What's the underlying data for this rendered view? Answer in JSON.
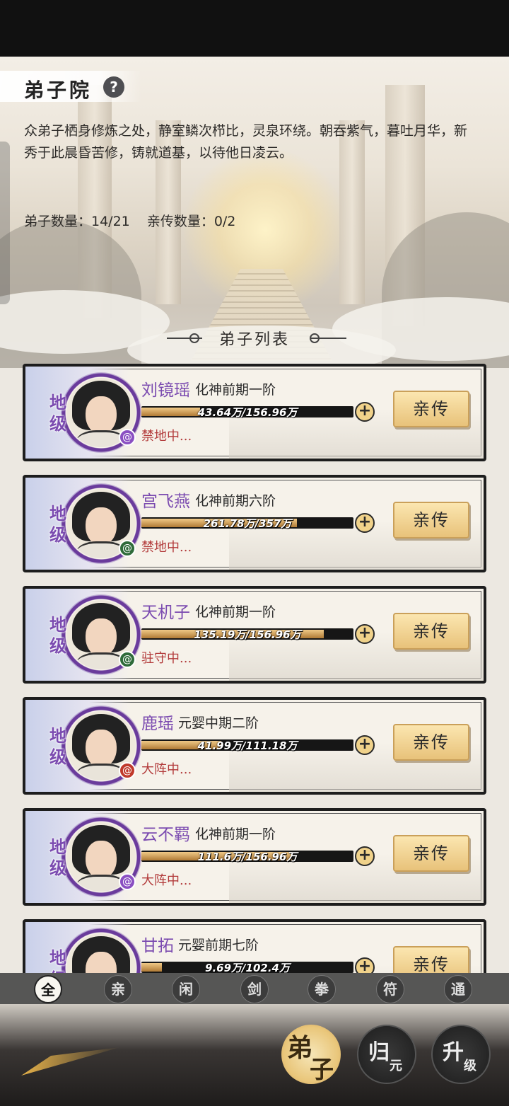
{
  "header": {
    "title": "弟子院",
    "help_icon": "?",
    "description": "众弟子栖身修炼之处，静室鳞次栉比，灵泉环绕。朝吞紫气，暮吐月华，新秀于此晨昏苦修，铸就道基，以待他日凌云。",
    "disciple_count": "弟子数量：14/21",
    "inner_count": "亲传数量：0/2"
  },
  "list": {
    "title": "弟子列表",
    "disciples": [
      {
        "grade": "地级",
        "name": "刘镜瑶",
        "realm": "化神前期一阶",
        "exp": "43.64万/156.96万",
        "progress": 0.278,
        "status": "禁地中...",
        "button": "亲传",
        "element_icon": "fire-swirl-icon",
        "element_color": "#8a4fc2"
      },
      {
        "grade": "地级",
        "name": "宫飞燕",
        "realm": "化神前期六阶",
        "exp": "261.78万/357万",
        "progress": 0.733,
        "status": "禁地中...",
        "button": "亲传",
        "element_icon": "wind-swirl-icon",
        "element_color": "#2f6b3a"
      },
      {
        "grade": "地级",
        "name": "天机子",
        "realm": "化神前期一阶",
        "exp": "135.19万/156.96万",
        "progress": 0.861,
        "status": "驻守中...",
        "button": "亲传",
        "element_icon": "wind-swirl-icon",
        "element_color": "#2f6b3a"
      },
      {
        "grade": "地级",
        "name": "鹿瑶",
        "realm": "元婴中期二阶",
        "exp": "41.99万/111.18万",
        "progress": 0.378,
        "status": "大阵中...",
        "button": "亲传",
        "element_icon": "fire-swirl-icon",
        "element_color": "#c0392b"
      },
      {
        "grade": "地级",
        "name": "云不羁",
        "realm": "化神前期一阶",
        "exp": "111.6万/156.96万",
        "progress": 0.711,
        "status": "大阵中...",
        "button": "亲传",
        "element_icon": "fire-swirl-icon",
        "element_color": "#8a4fc2"
      },
      {
        "grade": "地级",
        "name": "甘拓",
        "realm": "元婴前期七阶",
        "exp": "9.69万/102.4万",
        "progress": 0.095,
        "status": "",
        "button": "亲传",
        "element_icon": "fire-swirl-icon",
        "element_color": "#8a4fc2"
      }
    ]
  },
  "filters": [
    "全",
    "亲",
    "闲",
    "剑",
    "拳",
    "符",
    "通"
  ],
  "active_filter": "全",
  "nav": {
    "disciple": {
      "main": "弟",
      "sub": "子"
    },
    "return": {
      "main": "归",
      "sub": "元"
    },
    "upgrade": {
      "main": "升",
      "sub": "级"
    }
  }
}
